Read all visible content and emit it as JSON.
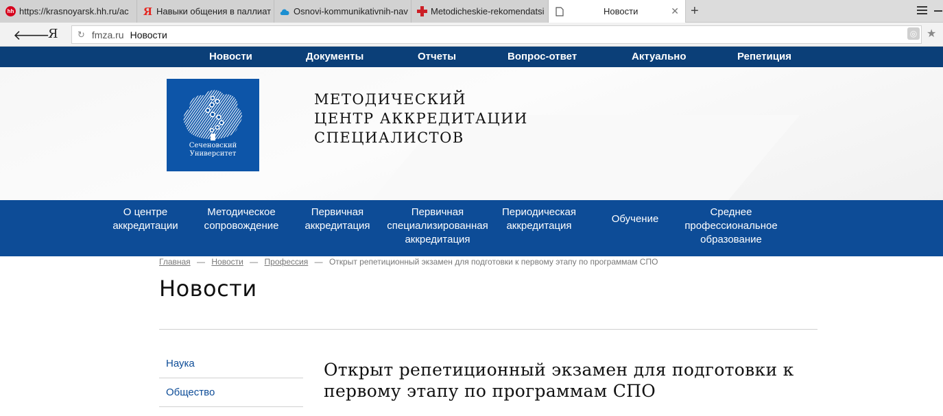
{
  "browser": {
    "tabs": [
      {
        "title": "https://krasnoyarsk.hh.ru/ac",
        "favicon": "hh-icon",
        "color": "#d6001c"
      },
      {
        "title": "Навыки общения в паллиат",
        "favicon": "yandex-icon",
        "color": "#e52620"
      },
      {
        "title": "Osnovi-kommunikativnih-nav",
        "favicon": "cloud-icon",
        "color": "#1c8fd1"
      },
      {
        "title": "Metodicheskie-rekomendatsi",
        "favicon": "cross-icon",
        "color": "#cc1f26"
      },
      {
        "title": "Новости",
        "favicon": "page-icon",
        "color": "#555555"
      }
    ],
    "address": {
      "domain": "fmza.ru",
      "page_title": "Новости"
    },
    "yandex_letter": "Я"
  },
  "top_nav": [
    "Новости",
    "Документы",
    "Отчеты",
    "Вопрос-ответ",
    "Актуально",
    "Репетиция"
  ],
  "logo": {
    "line1": "Сеченовский",
    "line2": "Университет"
  },
  "site_title": {
    "line1": "МЕТОДИЧЕСКИЙ",
    "line2": "ЦЕНТР АККРЕДИТАЦИИ",
    "line3": "СПЕЦИАЛИСТОВ"
  },
  "main_nav": [
    {
      "line1": "О центре",
      "line2": "аккредитации",
      "line3": ""
    },
    {
      "line1": "Методическое",
      "line2": "сопровождение",
      "line3": ""
    },
    {
      "line1": "Первичная",
      "line2": "аккредитация",
      "line3": ""
    },
    {
      "line1": "Первичная",
      "line2": "специализированная",
      "line3": "аккредитация"
    },
    {
      "line1": "Периодическая",
      "line2": "аккредитация",
      "line3": ""
    },
    {
      "line1": "Обучение",
      "line2": "",
      "line3": ""
    },
    {
      "line1": "Среднее",
      "line2": "профессиональное",
      "line3": "образование"
    }
  ],
  "breadcrumb": {
    "items": [
      "Главная",
      "Новости",
      "Профессия"
    ],
    "separator": "—",
    "current": "Открыт репетиционный экзамен для подготовки к первому этапу по программам СПО"
  },
  "page_heading": "Новости",
  "sidebar": [
    "Наука",
    "Общество"
  ],
  "article": {
    "title": "Открыт репетиционный экзамен для подготовки к первому этапу по программам СПО"
  },
  "colors": {
    "top_nav_bg": "#0b3f78",
    "main_nav_bg": "#0d4c97",
    "logo_bg": "#0d55a8",
    "link": "#0d4c97"
  }
}
